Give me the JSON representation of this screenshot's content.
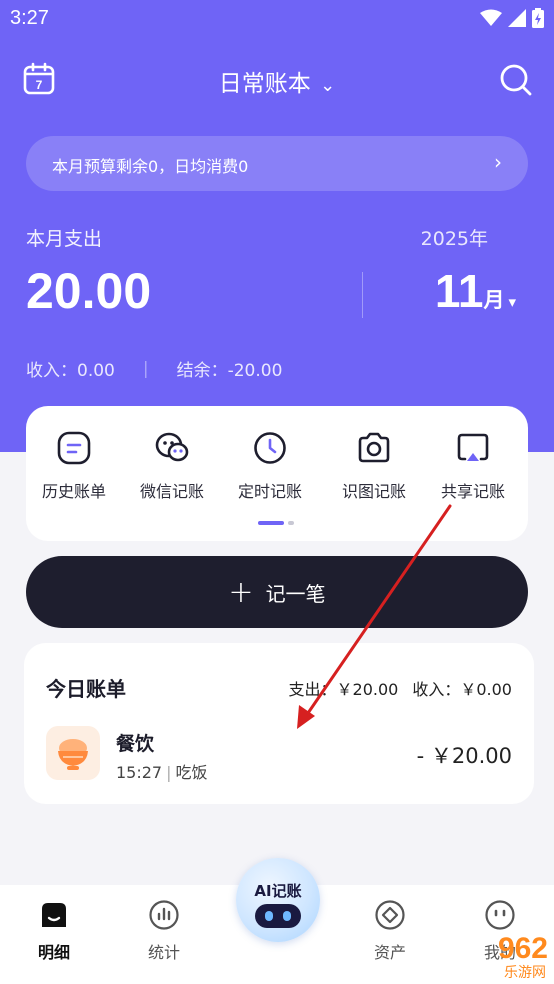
{
  "status_bar": {
    "time": "3:27"
  },
  "header": {
    "title": "日常账本",
    "title_caret": "⌄"
  },
  "budget": {
    "text": "本月预算剩余0，日均消费0",
    "arrow": "›"
  },
  "summary": {
    "expense_label": "本月支出",
    "expense_amount": "20.00",
    "year": "2025年",
    "month_number": "11",
    "month_unit": "月",
    "month_caret": "▾",
    "income_text": "收入：0.00",
    "separator": "|",
    "balance_text": "结余：-20.00"
  },
  "quick_actions": [
    {
      "label": "历史账单",
      "icon": "history-bill-icon"
    },
    {
      "label": "微信记账",
      "icon": "wechat-icon"
    },
    {
      "label": "定时记账",
      "icon": "clock-icon"
    },
    {
      "label": "识图记账",
      "icon": "camera-icon"
    },
    {
      "label": "共享记账",
      "icon": "share-screen-icon"
    }
  ],
  "add_button": {
    "plus": "+",
    "label": "记一笔"
  },
  "today": {
    "title": "今日账单",
    "expense": "支出：￥20.00",
    "income": "收入：￥0.00",
    "entries": [
      {
        "category": "餐饮",
        "time": "15:27",
        "bar": "|",
        "note": "吃饭",
        "amount": "- ￥20.00"
      }
    ]
  },
  "tabs": [
    {
      "label": "明细",
      "icon": "detail-icon",
      "active": true
    },
    {
      "label": "统计",
      "icon": "chart-icon",
      "active": false
    },
    {
      "label": "资产",
      "icon": "asset-icon",
      "active": false
    },
    {
      "label": "我的",
      "icon": "profile-icon",
      "active": false
    }
  ],
  "ai_button": {
    "label": "AI记账"
  },
  "watermark": {
    "brand": "962",
    "sub": "乐游网"
  },
  "colors": {
    "primary": "#6f64f6",
    "dark_button": "#1e1e2e",
    "annotation_arrow": "#d62020"
  }
}
